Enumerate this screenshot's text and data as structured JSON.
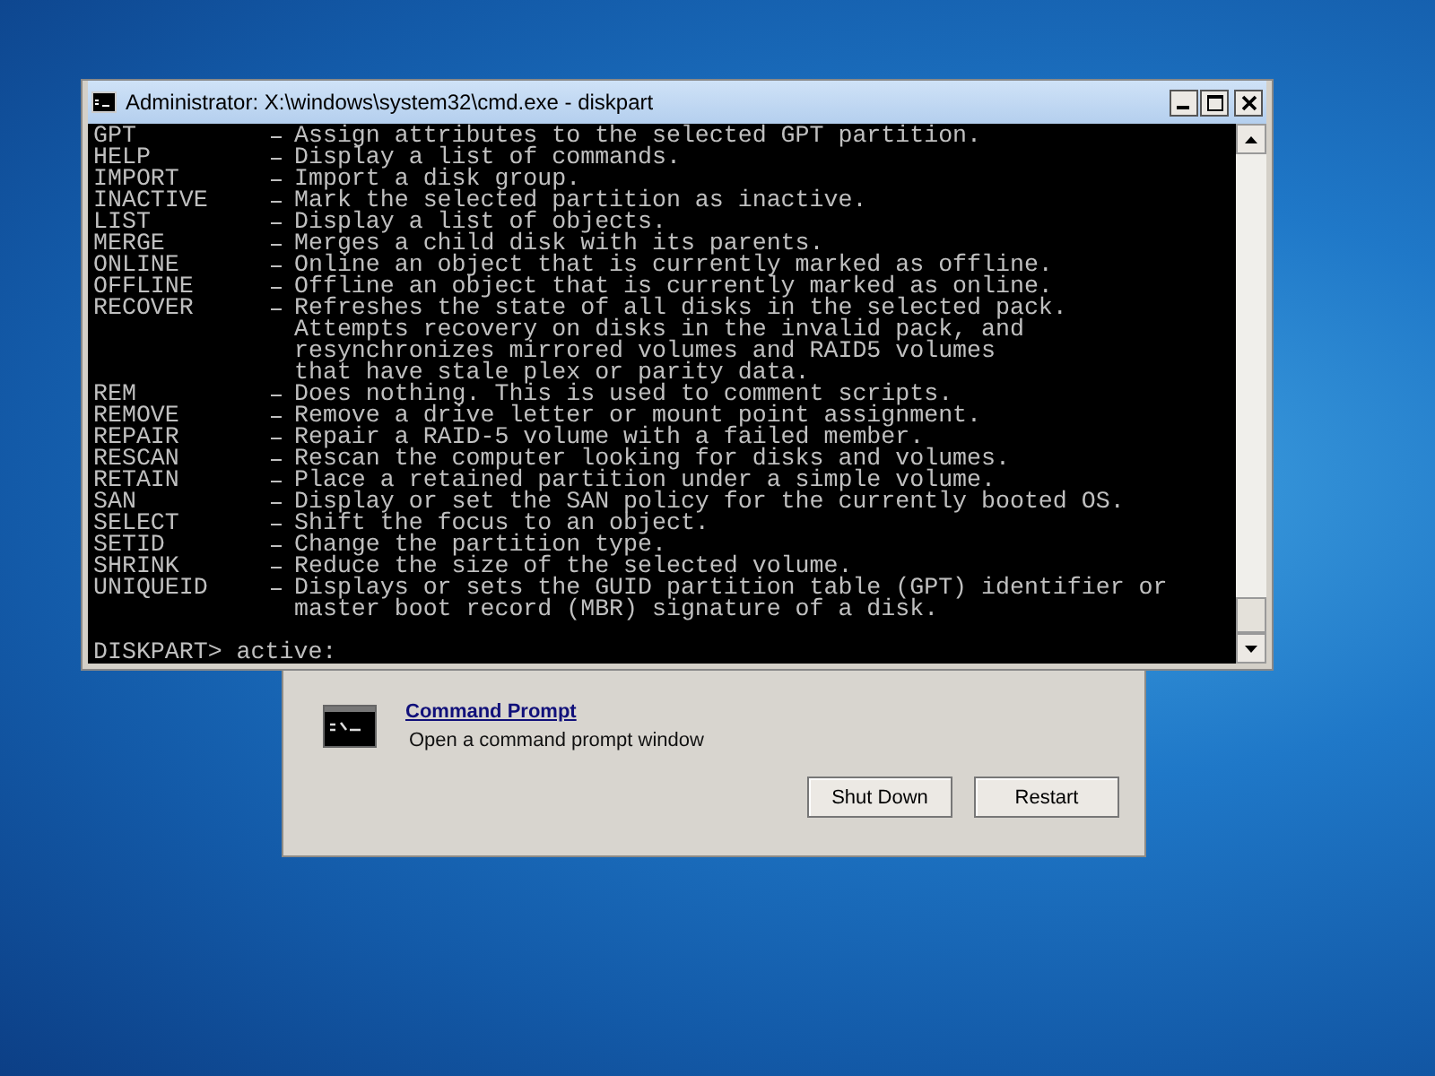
{
  "cmd_window": {
    "title": "Administrator: X:\\windows\\system32\\cmd.exe - diskpart",
    "help_entries": [
      {
        "command": "GPT",
        "description": [
          "Assign attributes to the selected GPT partition."
        ]
      },
      {
        "command": "HELP",
        "description": [
          "Display a list of commands."
        ]
      },
      {
        "command": "IMPORT",
        "description": [
          "Import a disk group."
        ]
      },
      {
        "command": "INACTIVE",
        "description": [
          "Mark the selected partition as inactive."
        ]
      },
      {
        "command": "LIST",
        "description": [
          "Display a list of objects."
        ]
      },
      {
        "command": "MERGE",
        "description": [
          "Merges a child disk with its parents."
        ]
      },
      {
        "command": "ONLINE",
        "description": [
          "Online an object that is currently marked as offline."
        ]
      },
      {
        "command": "OFFLINE",
        "description": [
          "Offline an object that is currently marked as online."
        ]
      },
      {
        "command": "RECOVER",
        "description": [
          "Refreshes the state of all disks in the selected pack.",
          "Attempts recovery on disks in the invalid pack, and",
          "resynchronizes mirrored volumes and RAID5 volumes",
          "that have stale plex or parity data."
        ]
      },
      {
        "command": "REM",
        "description": [
          "Does nothing. This is used to comment scripts."
        ]
      },
      {
        "command": "REMOVE",
        "description": [
          "Remove a drive letter or mount point assignment."
        ]
      },
      {
        "command": "REPAIR",
        "description": [
          "Repair a RAID-5 volume with a failed member."
        ]
      },
      {
        "command": "RESCAN",
        "description": [
          "Rescan the computer looking for disks and volumes."
        ]
      },
      {
        "command": "RETAIN",
        "description": [
          "Place a retained partition under a simple volume."
        ]
      },
      {
        "command": "SAN",
        "description": [
          "Display or set the SAN policy for the currently booted OS."
        ]
      },
      {
        "command": "SELECT",
        "description": [
          "Shift the focus to an object."
        ]
      },
      {
        "command": "SETID",
        "description": [
          "Change the partition type."
        ]
      },
      {
        "command": "SHRINK",
        "description": [
          "Reduce the size of the selected volume."
        ]
      },
      {
        "command": "UNIQUEID",
        "description": [
          "Displays or sets the GUID partition table (GPT) identifier or",
          "master boot record (MBR) signature of a disk."
        ]
      }
    ],
    "prompt": "DISKPART> active:"
  },
  "recovery_dialog": {
    "tool": {
      "name": "Command Prompt",
      "description": "Open a command prompt window"
    },
    "buttons": [
      "Shut Down",
      "Restart"
    ]
  }
}
